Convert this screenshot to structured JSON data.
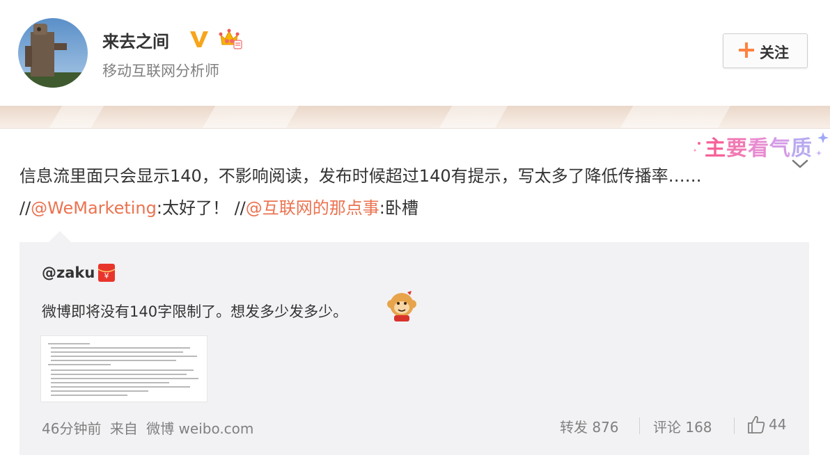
{
  "user": {
    "name": "来去之间",
    "title": "移动互联网分析师"
  },
  "follow_button": {
    "label": "关注"
  },
  "badge": {
    "chars": [
      "主",
      "要",
      "看",
      "气",
      "质"
    ]
  },
  "post": {
    "text_main": "信息流里面只会显示140，不影响阅读，发布时候超过140有提示，写太多了降低传播率…… //",
    "mention_1": "@WeMarketing",
    "reply_1": ":太好了！ //",
    "mention_2": "@互联网的那点事",
    "reply_2": ":卧槽"
  },
  "repost": {
    "original_user": "@zaku",
    "original_text": "微博即将没有140字限制了。想发多少发多少。",
    "time": "46分钟前",
    "source_prefix": "来自",
    "source": "微博 weibo.com",
    "forward_label": "转发",
    "forward_count": "876",
    "comment_label": "评论",
    "comment_count": "168",
    "like_count": "44"
  },
  "colors": {
    "accent": "#eb7350",
    "follow_plus": "#ff8140",
    "verified": "#f7a51c",
    "repost_bg": "#f2f2f5"
  },
  "icons": [
    "verified-v-icon",
    "vip-crown-icon",
    "plus-icon",
    "chevron-down-icon",
    "red-packet-icon",
    "monkey-emoji-icon",
    "thumbs-up-icon"
  ]
}
